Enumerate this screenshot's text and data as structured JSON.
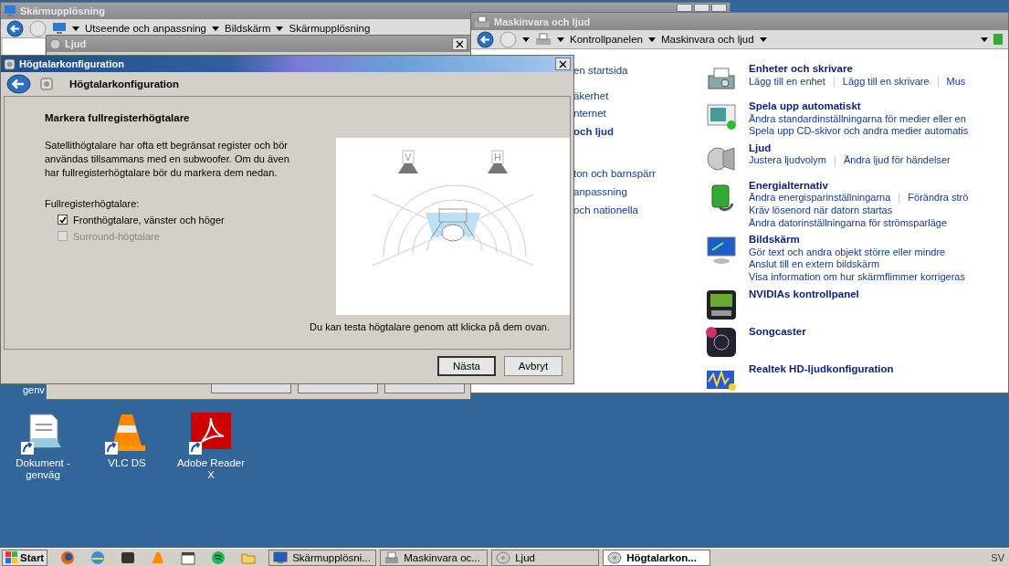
{
  "desktop": {
    "covered_label": "genv",
    "icons": [
      {
        "label": "Dokument - genväg",
        "kind": "document"
      },
      {
        "label": "VLC DS",
        "kind": "cone"
      },
      {
        "label": "Adobe Reader X",
        "kind": "pdf"
      }
    ]
  },
  "display_window": {
    "title": "Skärmupplösning",
    "breadcrumbs": [
      "Utseende och anpassning",
      "Bildskärm",
      "Skärmupplösning"
    ]
  },
  "sound_window": {
    "title": "Ljud"
  },
  "hardware_window": {
    "title": "Maskinvara och ljud",
    "breadcrumbs": [
      "Kontrollpanelen",
      "Maskinvara och ljud"
    ],
    "nav": [
      [
        {
          "label": "en startsida",
          "selected": false
        }
      ],
      [
        {
          "label": "äkerhet",
          "selected": false
        },
        {
          "label": "nternet",
          "selected": false
        },
        {
          "label": "och ljud",
          "selected": true
        }
      ],
      [
        {
          "label": "ton och barnspärr",
          "selected": false
        },
        {
          "label": "anpassning",
          "selected": false
        },
        {
          "label": "och nationella",
          "selected": false
        }
      ]
    ],
    "categories": [
      {
        "title": "Enheter och skrivare",
        "kind": "printer",
        "lines": [
          [
            "Lägg till en enhet",
            "Lägg till en skrivare",
            "Mus"
          ]
        ]
      },
      {
        "title": "Spela upp automatiskt",
        "kind": "autoplay",
        "lines": [
          [
            "Ändra standardinställningarna för medier eller en"
          ],
          [
            "Spela upp CD-skivor och andra medier automatis"
          ]
        ]
      },
      {
        "title": "Ljud",
        "kind": "speaker",
        "lines": [
          [
            "Justera ljudvolym",
            "Ändra ljud för händelser"
          ]
        ]
      },
      {
        "title": "Energialternativ",
        "kind": "battery",
        "lines": [
          [
            "Ändra energisparinställningarna",
            "Förändra strö"
          ],
          [
            "Kräv lösenord när datorn startas"
          ],
          [
            "Ändra datorinställningarna för strömsparläge"
          ]
        ]
      },
      {
        "title": "Bildskärm",
        "kind": "monitor",
        "lines": [
          [
            "Gör text och andra objekt större eller mindre"
          ],
          [
            "Anslut till en extern bildskärm"
          ],
          [
            "Visa information om hur skärmflimmer korrigeras"
          ]
        ]
      },
      {
        "title": "NVIDIAs kontrollpanel",
        "kind": "gpu"
      },
      {
        "title": "Songcaster",
        "kind": "app"
      },
      {
        "title": "Realtek HD-ljudkonfiguration",
        "kind": "audio"
      }
    ]
  },
  "dialog": {
    "title": "Högtalarkonfiguration",
    "header": "Högtalarkonfiguration",
    "heading": "Markera fullregisterhögtalare",
    "description": "Satellithögtalare har ofta ett begränsat register och bör användas tillsammans med en subwoofer. Om du även har fullregisterhögtalare bör du markera dem nedan.",
    "speakers": [
      {
        "label": "V"
      },
      {
        "label": "H"
      }
    ],
    "group_label": "Fullregisterhögtalare:",
    "options": [
      {
        "label": "Fronthögtalare, vänster och höger",
        "checked": true,
        "disabled": false
      },
      {
        "label": "Surround-högtalare",
        "checked": false,
        "disabled": true
      }
    ],
    "hint": "Du kan testa högtalare genom att klicka på dem ovan.",
    "buttons": [
      {
        "label": "Nästa",
        "default": true
      },
      {
        "label": "Avbryt",
        "default": false
      }
    ]
  },
  "taskbar": {
    "start": "Start",
    "tasks": [
      {
        "label": "Skärmupplösni...",
        "kind": "display",
        "selected": false
      },
      {
        "label": "Maskinvara oc...",
        "kind": "hardware",
        "selected": false
      },
      {
        "label": "Ljud",
        "kind": "sound",
        "selected": false
      },
      {
        "label": "Högtalarkon...",
        "kind": "sound",
        "selected": true
      }
    ],
    "language": "SV"
  }
}
